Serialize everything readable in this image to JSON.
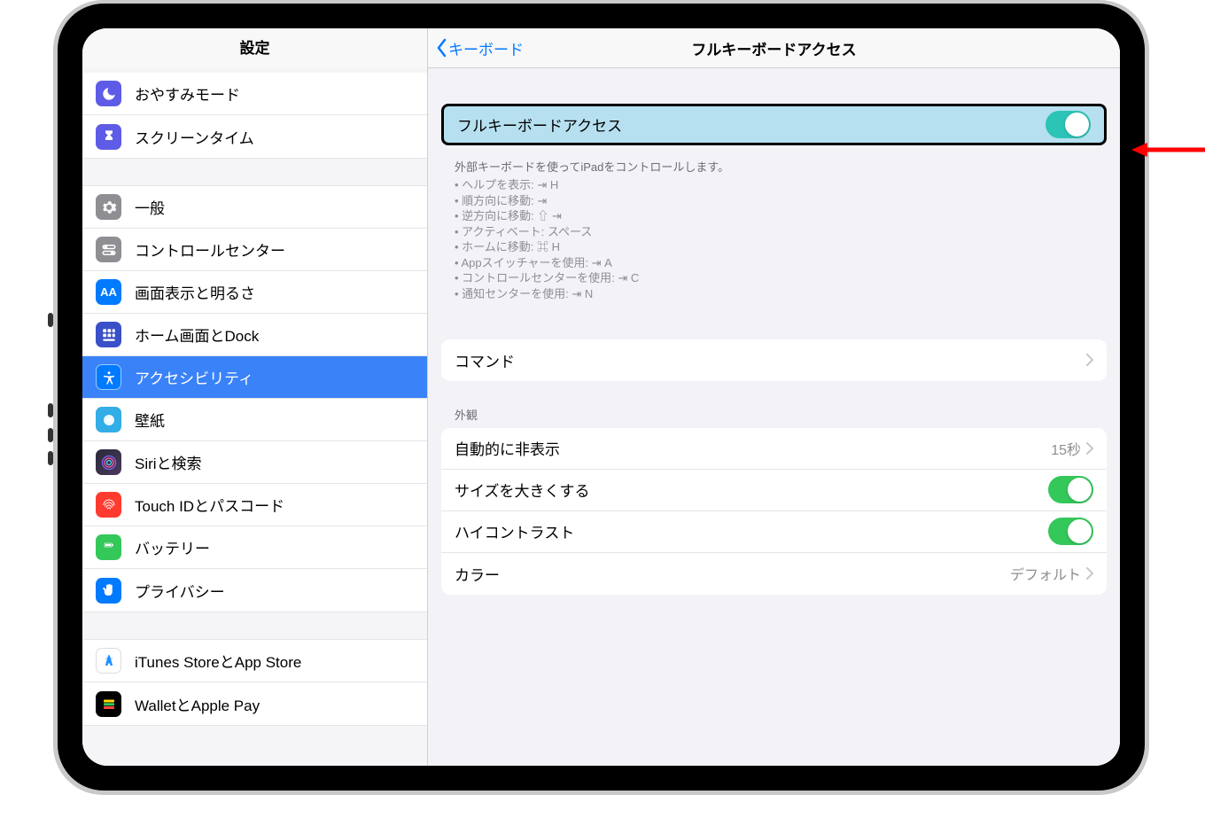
{
  "sidebar": {
    "title": "設定",
    "group1": [
      {
        "label": "おやすみモード",
        "icon": "moon-icon",
        "bg": "#5e5ce6"
      },
      {
        "label": "スクリーンタイム",
        "icon": "hourglass-icon",
        "bg": "#5e5ce6"
      }
    ],
    "group2": [
      {
        "label": "一般",
        "icon": "gear-icon",
        "bg": "#8e8e93"
      },
      {
        "label": "コントロールセンター",
        "icon": "switches-icon",
        "bg": "#8e8e93"
      },
      {
        "label": "画面表示と明るさ",
        "icon": "text-size-icon",
        "bg": "#007aff"
      },
      {
        "label": "ホーム画面とDock",
        "icon": "home-grid-icon",
        "bg": "#3a50c8"
      },
      {
        "label": "アクセシビリティ",
        "icon": "accessibility-icon",
        "bg": "#007aff",
        "selected": true
      },
      {
        "label": "壁紙",
        "icon": "wallpaper-icon",
        "bg": "#32ade6"
      },
      {
        "label": "Siriと検索",
        "icon": "siri-icon",
        "bg": "#000"
      },
      {
        "label": "Touch IDとパスコード",
        "icon": "fingerprint-icon",
        "bg": "#ff3b30"
      },
      {
        "label": "バッテリー",
        "icon": "battery-icon",
        "bg": "#34c759"
      },
      {
        "label": "プライバシー",
        "icon": "hand-icon",
        "bg": "#007aff"
      }
    ],
    "group3": [
      {
        "label": "iTunes StoreとApp Store",
        "icon": "appstore-icon",
        "bg": "#fff"
      },
      {
        "label": "WalletとApple Pay",
        "icon": "wallet-icon",
        "bg": "#000"
      }
    ]
  },
  "detail": {
    "back": "キーボード",
    "title": "フルキーボードアクセス",
    "toggle_row": {
      "label": "フルキーボードアクセス",
      "on": true
    },
    "footer": {
      "lead": "外部キーボードを使ってiPadをコントロールします。",
      "items": [
        "ヘルプを表示: ⇥ H",
        "順方向に移動: ⇥",
        "逆方向に移動: ⇧ ⇥",
        "アクティベート: スペース",
        "ホームに移動: ⌘ H",
        "Appスイッチャーを使用: ⇥ A",
        "コントロールセンターを使用: ⇥ C",
        "通知センターを使用: ⇥ N"
      ]
    },
    "commands": {
      "label": "コマンド"
    },
    "appearance_header": "外観",
    "appearance": [
      {
        "label": "自動的に非表示",
        "value": "15秒",
        "type": "link"
      },
      {
        "label": "サイズを大きくする",
        "type": "toggle",
        "on": true
      },
      {
        "label": "ハイコントラスト",
        "type": "toggle",
        "on": true
      },
      {
        "label": "カラー",
        "value": "デフォルト",
        "type": "link"
      }
    ]
  }
}
